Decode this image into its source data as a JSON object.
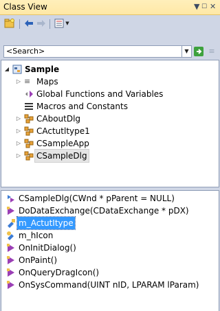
{
  "window": {
    "title": "Class View",
    "controls": {
      "dropdown": "▼",
      "close": "✕"
    }
  },
  "toolbar": {
    "icons": [
      "new-folder-icon",
      "back-arrow-icon",
      "forward-arrow-icon",
      "settings-icon",
      "dropdown-arrow-icon"
    ]
  },
  "search": {
    "placeholder": "<Search>"
  },
  "tree": {
    "root": {
      "label": "Sample",
      "expanded": true
    },
    "items": [
      {
        "label": "Maps",
        "expandable": true,
        "icon": "map-icon"
      },
      {
        "label": "Global Functions and Variables",
        "expandable": false,
        "icon": "global-functions-icon"
      },
      {
        "label": "Macros and Constants",
        "expandable": false,
        "icon": "macros-icon"
      },
      {
        "label": "CAboutDlg",
        "expandable": true,
        "icon": "class-icon"
      },
      {
        "label": "CActutltype1",
        "expandable": true,
        "icon": "class-icon"
      },
      {
        "label": "CSampleApp",
        "expandable": true,
        "icon": "class-icon"
      },
      {
        "label": "CSampleDlg",
        "expandable": true,
        "icon": "class-icon",
        "hovered": true
      }
    ]
  },
  "members": [
    {
      "label": "CSampleDlg(CWnd * pParent = NULL)",
      "icon": "method-icon"
    },
    {
      "label": "DoDataExchange(CDataExchange * pDX)",
      "icon": "protected-method-icon"
    },
    {
      "label": "m_ActutItype",
      "icon": "field-icon",
      "selected": true
    },
    {
      "label": "m_hIcon",
      "icon": "field-icon"
    },
    {
      "label": "OnInitDialog()",
      "icon": "protected-method-icon"
    },
    {
      "label": "OnPaint()",
      "icon": "protected-method-icon"
    },
    {
      "label": "OnQueryDragIcon()",
      "icon": "protected-method-icon"
    },
    {
      "label": "OnSysCommand(UINT nID, LPARAM lParam)",
      "icon": "protected-method-icon"
    }
  ],
  "colors": {
    "titlebar": "#ffefbb",
    "selection": "#3399ff",
    "class_icon": "#e8a33a",
    "method_icon": "#9b3fb5"
  }
}
